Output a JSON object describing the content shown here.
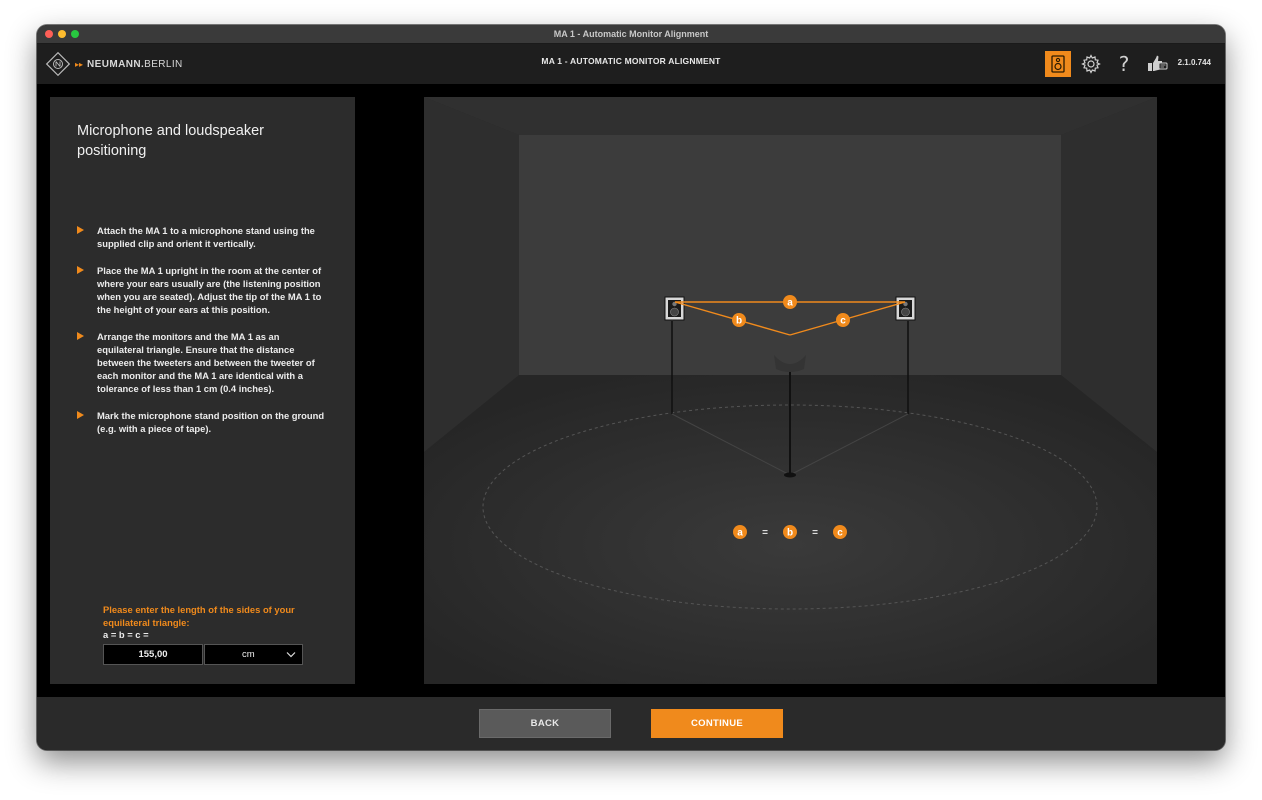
{
  "window": {
    "title": "MA 1 - Automatic Monitor Alignment"
  },
  "header": {
    "brand_bold": "NEUMANN.",
    "brand_thin": "BERLIN",
    "title": "MA 1 - AUTOMATIC MONITOR ALIGNMENT",
    "version": "2.1.0.744",
    "icons": [
      "speaker-icon",
      "gear-icon",
      "help-icon",
      "feedback-icon"
    ],
    "accent_color": "#f08a1c"
  },
  "panel": {
    "title": "Microphone and loudspeaker positioning",
    "bullets": [
      "Attach the MA 1 to a microphone stand using the supplied clip and orient it vertically.",
      "Place the MA 1 upright in the room at the center of where your ears usually are (the listening position when you are seated). Adjust the tip of the MA 1 to the height of your ears at this position.",
      "Arrange the monitors and the MA 1 as an equilateral triangle. Ensure that the distance between the tweeters and between the tweeter of each monitor and the MA 1 are identical with a tolerance of less than 1 cm (0.4 inches).",
      "Mark the microphone stand position on the ground (e.g. with a piece of tape)."
    ],
    "prompt": "Please enter the length of the sides of your equilateral triangle:",
    "formula": "a = b = c =",
    "length_value": "155,00",
    "unit_value": "cm"
  },
  "scene": {
    "labels": {
      "a": "a",
      "b": "b",
      "c": "c"
    },
    "equals": "="
  },
  "footer": {
    "back_label": "BACK",
    "continue_label": "CONTINUE"
  }
}
